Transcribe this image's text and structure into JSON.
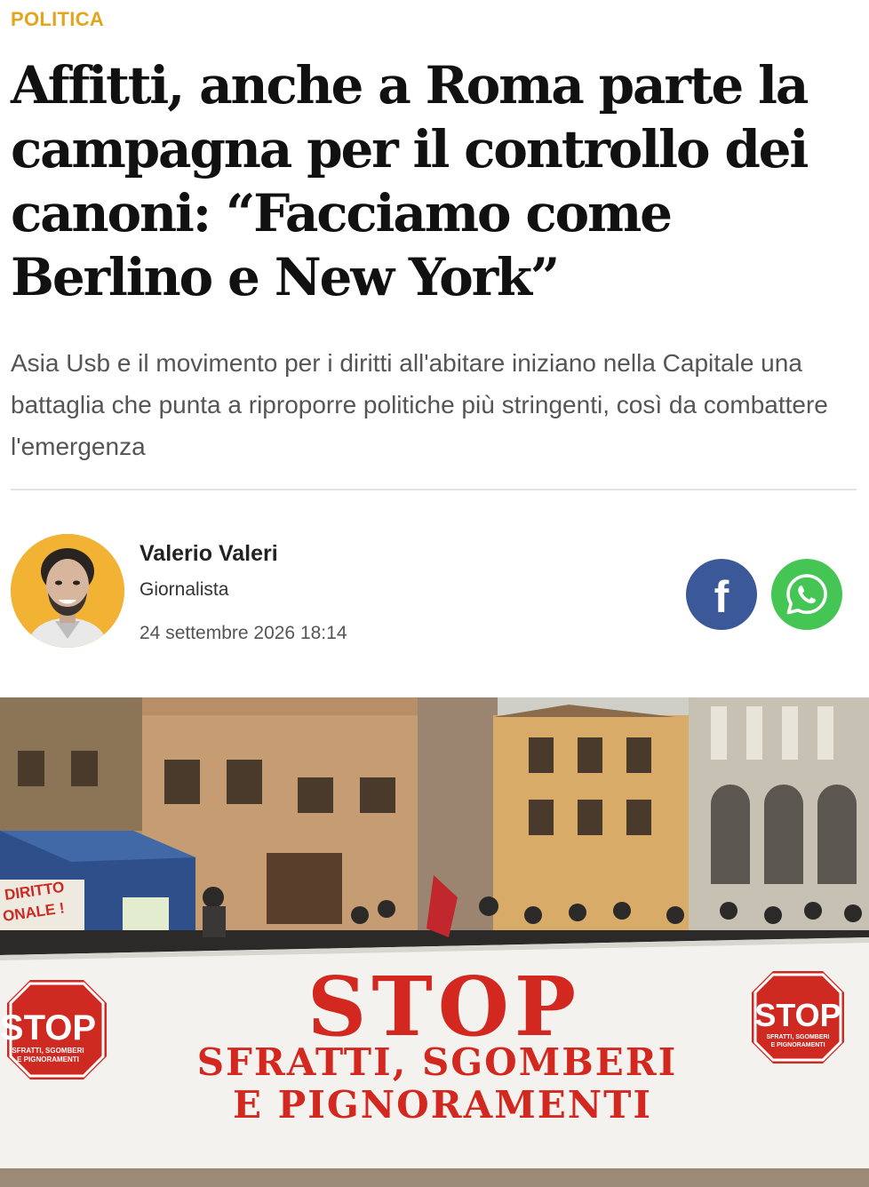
{
  "article": {
    "section": "POLITICA",
    "title": "Affitti, anche a Roma parte la campagna per il controllo dei canoni: “Facciamo come Berlino e New York”",
    "subtitle": "Asia Usb e il movimento per i diritti all'abitare iniziano nella Capitale una battaglia che punta a riproporre politiche più stringenti, così da combattere l'emergenza"
  },
  "author": {
    "name": "Valerio Valeri",
    "role": "Giornalista",
    "date": "24 settembre 2026 18:14",
    "avatar_icon": "author-portrait"
  },
  "share": {
    "facebook_icon": "facebook-icon",
    "whatsapp_icon": "whatsapp-icon",
    "facebook_color": "#3b5998",
    "whatsapp_color": "#44c554"
  },
  "hero_image": {
    "banner_main": "STOP",
    "banner_line1": "SFRATTI, SGOMBERI",
    "banner_line2": "E PIGNORAMENTI",
    "sign_text": "STOP",
    "sign_small_1": "SFRATTI, SGOMBERI",
    "sign_small_2": "E PIGNORAMENTI",
    "tent_sign_1": "DIRITTO",
    "tent_sign_2": "ONALE !"
  },
  "colors": {
    "accent": "#e3a51b",
    "headline": "#111111",
    "subtitle": "#555555",
    "banner_red": "#d2281f"
  }
}
